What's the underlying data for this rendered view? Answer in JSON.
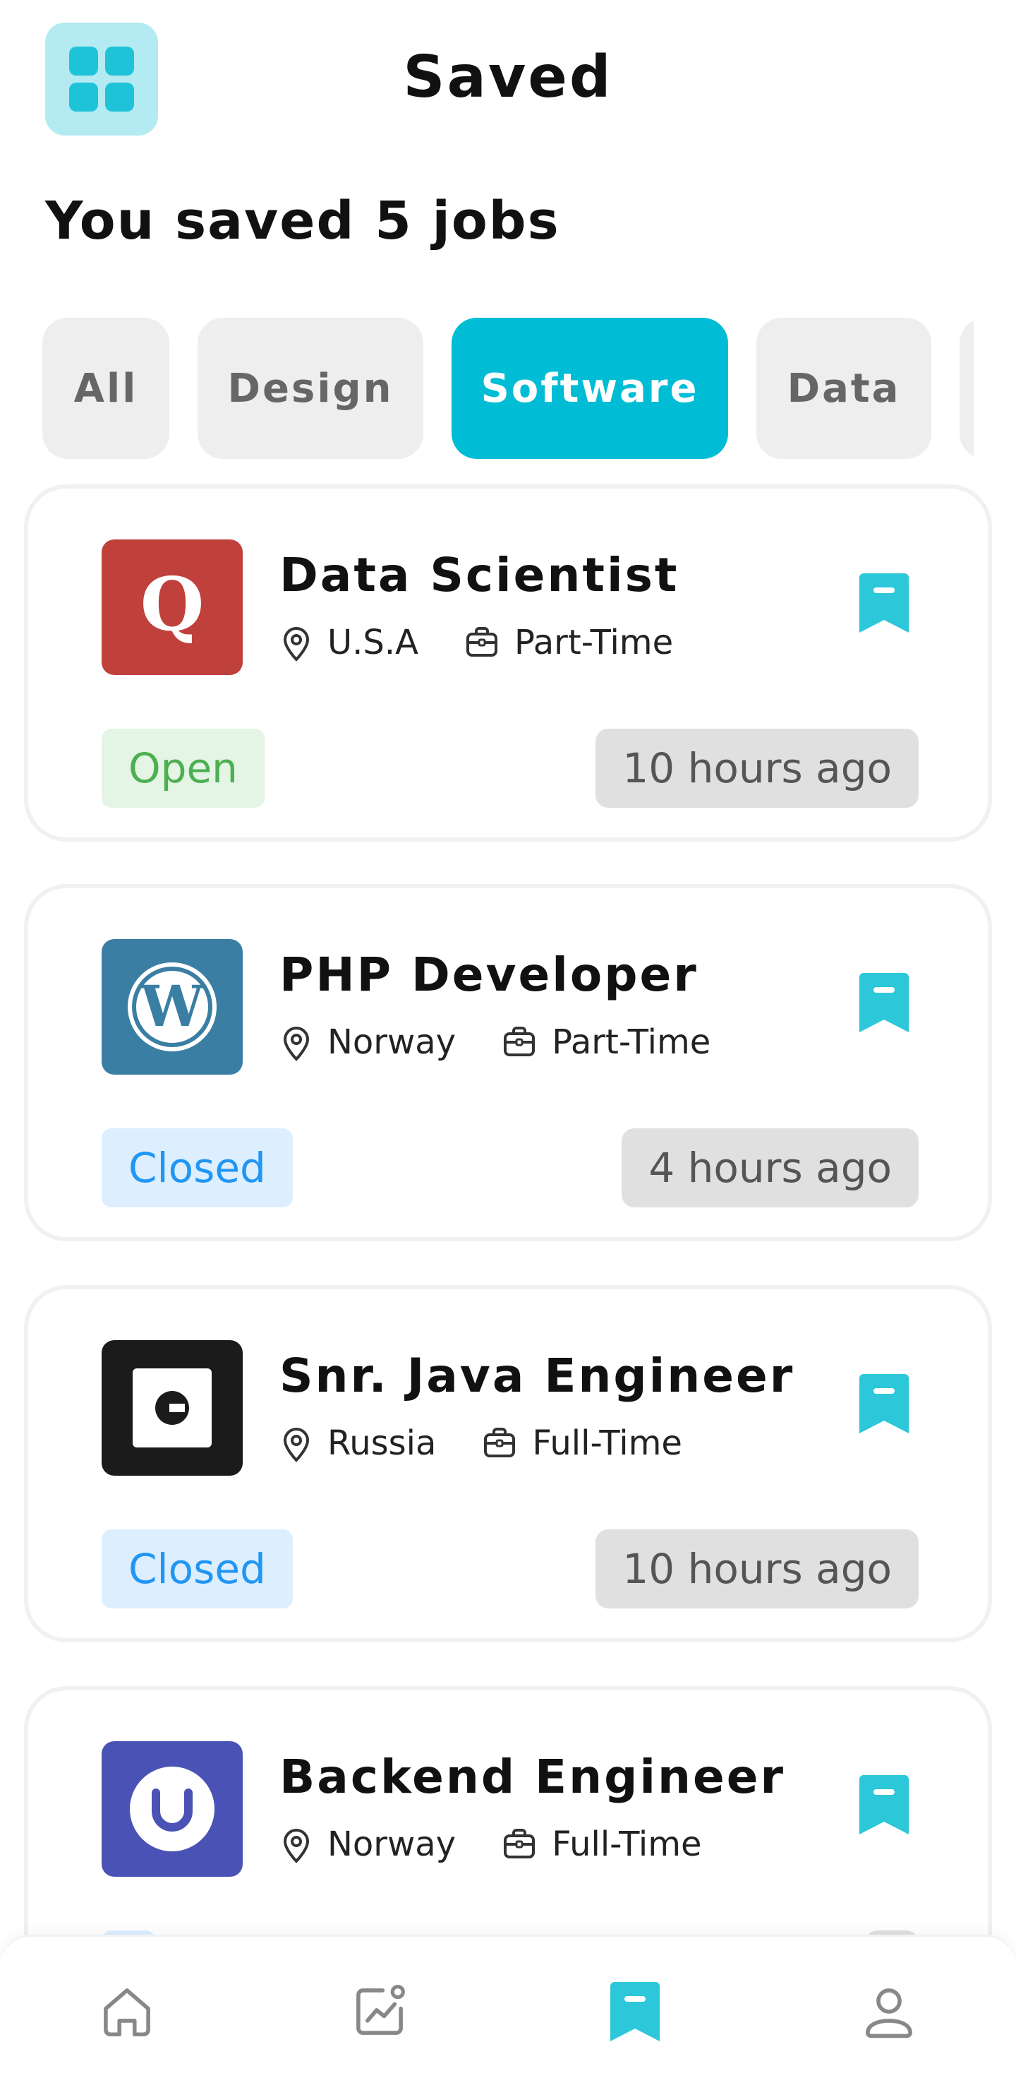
{
  "header": {
    "title": "Saved",
    "menu_icon": "grid-menu-icon"
  },
  "summary": "You saved 5 jobs",
  "filters": [
    {
      "label": "All",
      "active": false
    },
    {
      "label": "Design",
      "active": false
    },
    {
      "label": "Software",
      "active": true
    },
    {
      "label": "Data",
      "active": false
    }
  ],
  "jobs": [
    {
      "title": "Data Scientist",
      "company_logo": "quora-logo",
      "location": "U.S.A",
      "type": "Part-Time",
      "status": "Open",
      "posted": "10 hours ago"
    },
    {
      "title": "PHP Developer",
      "company_logo": "wordpress-logo",
      "location": "Norway",
      "type": "Part-Time",
      "status": "Closed",
      "posted": "4 hours ago"
    },
    {
      "title": "Snr. Java Engineer",
      "company_logo": "uber-logo",
      "location": "Russia",
      "type": "Full-Time",
      "status": "Closed",
      "posted": "10 hours ago"
    },
    {
      "title": "Backend Engineer",
      "company_logo": "umbraco-logo",
      "location": "Norway",
      "type": "Full-Time",
      "status": "",
      "posted": ""
    }
  ],
  "colors": {
    "accent": "#00bcd4",
    "open": "#4caf50",
    "closed": "#2196f3",
    "quora": "#c0403c",
    "wordpress": "#3a7fa3",
    "uber": "#1b1b1b",
    "umbraco": "#4a52b5"
  },
  "nav": [
    {
      "icon": "home-icon",
      "active": false
    },
    {
      "icon": "analytics-icon",
      "active": false
    },
    {
      "icon": "bookmark-icon",
      "active": true
    },
    {
      "icon": "profile-icon",
      "active": false
    }
  ]
}
